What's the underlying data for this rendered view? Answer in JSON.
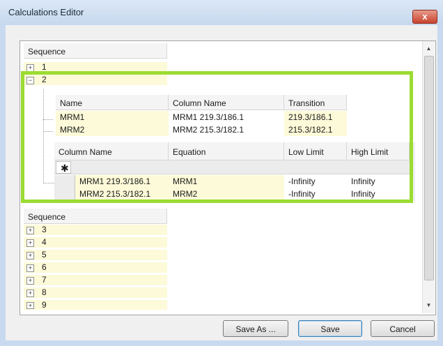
{
  "window": {
    "title": "Calculations Editor",
    "close_label": "x"
  },
  "tree": {
    "sequence_header": "Sequence",
    "expanded_items": [
      {
        "number": "1",
        "expanded": false
      },
      {
        "number": "2",
        "expanded": true
      }
    ],
    "collapsed_items": [
      "3",
      "4",
      "5",
      "6",
      "7",
      "8",
      "9"
    ]
  },
  "transitions_table": {
    "headers": [
      "Name",
      "Column Name",
      "Transition"
    ],
    "rows": [
      [
        "MRM1",
        "MRM1 219.3/186.1",
        "219.3/186.1"
      ],
      [
        "MRM2",
        "MRM2 215.3/182.1",
        "215.3/182.1"
      ]
    ]
  },
  "calculations_table": {
    "headers": [
      "Column Name",
      "Equation",
      "Low Limit",
      "High Limit"
    ],
    "new_row_marker": "✱",
    "rows": [
      [
        "MRM1 219.3/186.1",
        "MRM1",
        "-Infinity",
        "Infinity"
      ],
      [
        "MRM2 215.3/182.1",
        "MRM2",
        "-Infinity",
        "Infinity"
      ]
    ]
  },
  "buttons": {
    "save_as": "Save As ...",
    "save": "Save",
    "cancel": "Cancel"
  },
  "colors": {
    "highlight_border": "#9bdc32",
    "editable_cell": "#fcfad8"
  }
}
